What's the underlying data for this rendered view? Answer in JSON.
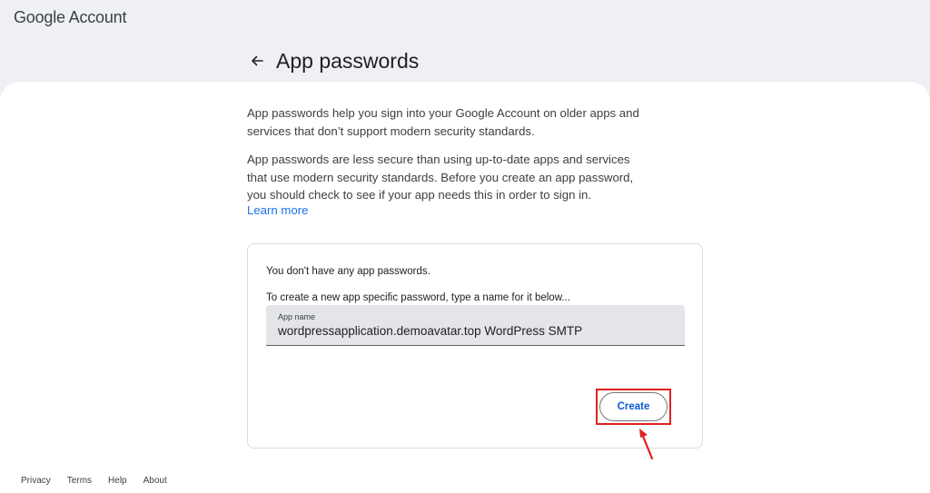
{
  "header": {
    "logo_google": "Google",
    "logo_account": "Account",
    "page_title": "App passwords"
  },
  "intro": {
    "paragraph_1": "App passwords help you sign into your Google Account on older apps and services that don’t support modern security standards.",
    "paragraph_2": "App passwords are less secure than using up-to-date apps and services that use modern security standards. Before you create an app password, you should check to see if your app needs this in order to sign in.",
    "learn_more": "Learn more"
  },
  "card": {
    "no_passwords_text": "You don't have any app passwords.",
    "instruction_text": "To create a new app specific password, type a name for it below...",
    "field_label": "App name",
    "field_value": "wordpressapplication.demoavatar.top WordPress SMTP",
    "create_label": "Create"
  },
  "footer": {
    "links": [
      "Privacy",
      "Terms",
      "Help",
      "About"
    ]
  },
  "colors": {
    "accent": "#1a73e8",
    "annotation_red": "#e0201e",
    "background_top": "#eef0f3"
  },
  "icons": {
    "back": "arrow-back-icon",
    "annotation": "red-arrow-icon"
  }
}
